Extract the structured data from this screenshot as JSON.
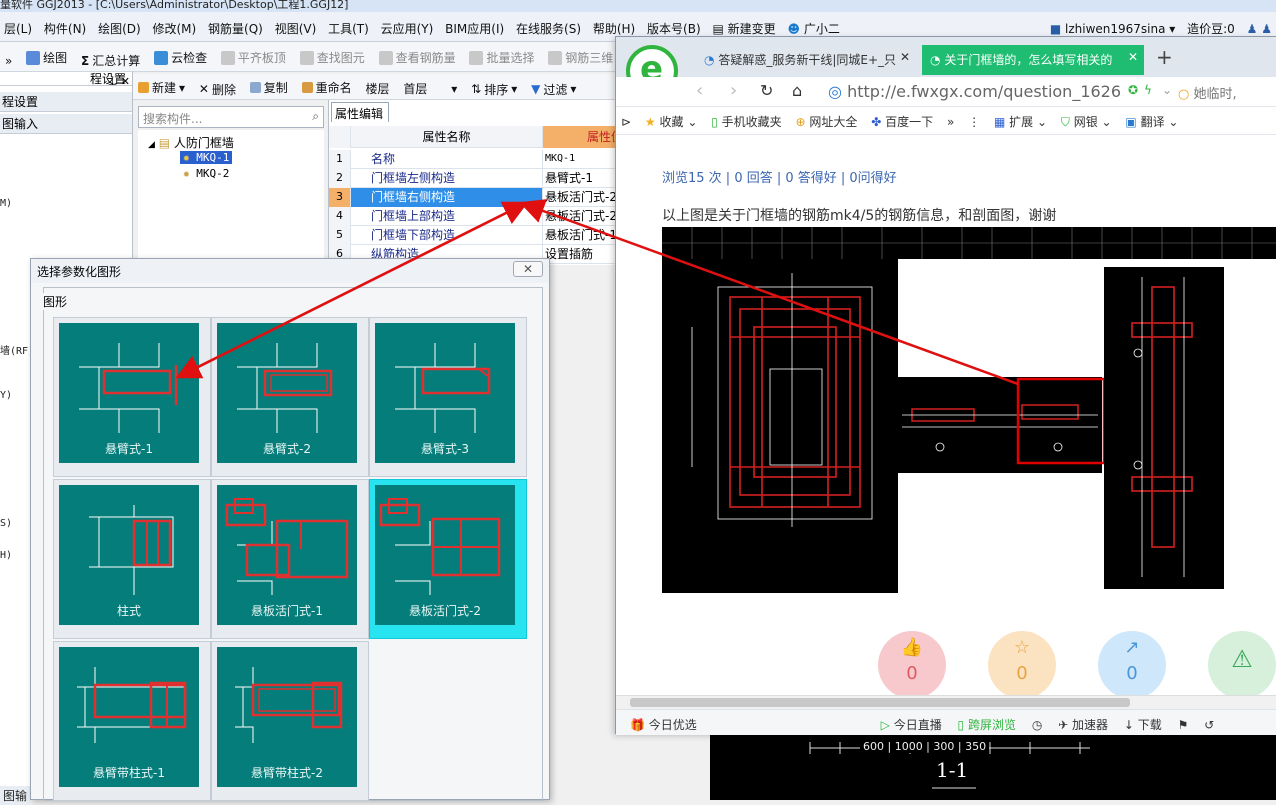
{
  "app": {
    "title": "量软件 GGJ2013 - [C:\\Users\\Administrator\\Desktop\\工程1.GGJ12]"
  },
  "menu": {
    "items": [
      "层(L)",
      "构件(N)",
      "绘图(D)",
      "修改(M)",
      "钢筋量(Q)",
      "视图(V)",
      "工具(T)",
      "云应用(Y)",
      "BIM应用(I)",
      "在线服务(S)",
      "帮助(H)",
      "版本号(B)",
      "新建变更",
      "广小二"
    ],
    "user": "lzhiwen1967sina",
    "cost_label": "造价豆:0"
  },
  "toolbar1": {
    "items": [
      "绘图",
      "汇总计算",
      "云检查",
      "平齐板顶",
      "查找图元",
      "查看钢筋量",
      "批量选择",
      "钢筋三维"
    ]
  },
  "left_panel": {
    "header1": "程设置",
    "header2": "图输入",
    "rows": [
      "M)",
      "墙(RF)",
      "Y)",
      "S)",
      "H)"
    ],
    "bottom_tab": "图输"
  },
  "toolbar2": {
    "items": [
      "新建",
      "删除",
      "复制",
      "重命名",
      "楼层",
      "首层",
      "排序",
      "过滤"
    ]
  },
  "search": {
    "placeholder": "搜索构件..."
  },
  "tree": {
    "root": "人防门框墙",
    "children": [
      "MKQ-1",
      "MKQ-2"
    ]
  },
  "property_grid": {
    "tab": "属性编辑",
    "header_name": "属性名称",
    "header_value": "属性值",
    "rows": [
      {
        "num": "1",
        "name": "名称",
        "value": "MKQ-1"
      },
      {
        "num": "2",
        "name": "门框墙左侧构造",
        "value": "悬臂式-1"
      },
      {
        "num": "3",
        "name": "门框墙右侧构造",
        "value": "悬板活门式-2"
      },
      {
        "num": "4",
        "name": "门框墙上部构造",
        "value": "悬板活门式-2"
      },
      {
        "num": "5",
        "name": "门框墙下部构造",
        "value": "悬板活门式-1"
      },
      {
        "num": "6",
        "name": "纵筋构造",
        "value": "设置插筋"
      }
    ]
  },
  "dialog": {
    "title": "选择参数化图形",
    "group_label": "图形",
    "close_label": "✕",
    "shapes": [
      {
        "label": "悬臂式-1",
        "selected": false
      },
      {
        "label": "悬臂式-2",
        "selected": false
      },
      {
        "label": "悬臂式-3",
        "selected": false
      },
      {
        "label": "柱式",
        "selected": false
      },
      {
        "label": "悬板活门式-1",
        "selected": false
      },
      {
        "label": "悬板活门式-2",
        "selected": true
      },
      {
        "label": "悬臂带柱式-1",
        "selected": false
      },
      {
        "label": "悬臂带柱式-2",
        "selected": false
      }
    ]
  },
  "browser": {
    "tab1": "答疑解惑_服务新干线|同城E+_只",
    "tab2": "关于门框墙的，怎么填写相关的",
    "url": "http://e.fwxgx.com/question_1626",
    "search_hint": "她临时,",
    "bookmarks": [
      "收藏",
      "手机收藏夹",
      "网址大全",
      "百度一下",
      "扩展",
      "网银",
      "翻译"
    ],
    "stats": "浏览15 次 | 0 回答 | 0 答得好 | 0问得好",
    "question": "以上图是关于门框墙的钢筋mk4/5的钢筋信息，和剖面图，谢谢",
    "actions": [
      {
        "icon": "👍",
        "count": "0",
        "color": "#f7c9cc",
        "text_color": "#e05a62"
      },
      {
        "icon": "☆",
        "count": "0",
        "color": "#fbe3c2",
        "text_color": "#e7a443"
      },
      {
        "icon": "↗",
        "count": "0",
        "color": "#cfe7fa",
        "text_color": "#4b96d6"
      },
      {
        "icon": "⚠",
        "count": "",
        "color": "#d6f0dc",
        "text_color": "#3aa85a"
      }
    ],
    "status": [
      "今日优选",
      "今日直播",
      "跨屏浏览",
      "加速器",
      "下载"
    ],
    "tab_new": "+"
  },
  "cad_bottom": {
    "dims": "600 | 1000 | 300 | 350",
    "section": "1-1"
  }
}
